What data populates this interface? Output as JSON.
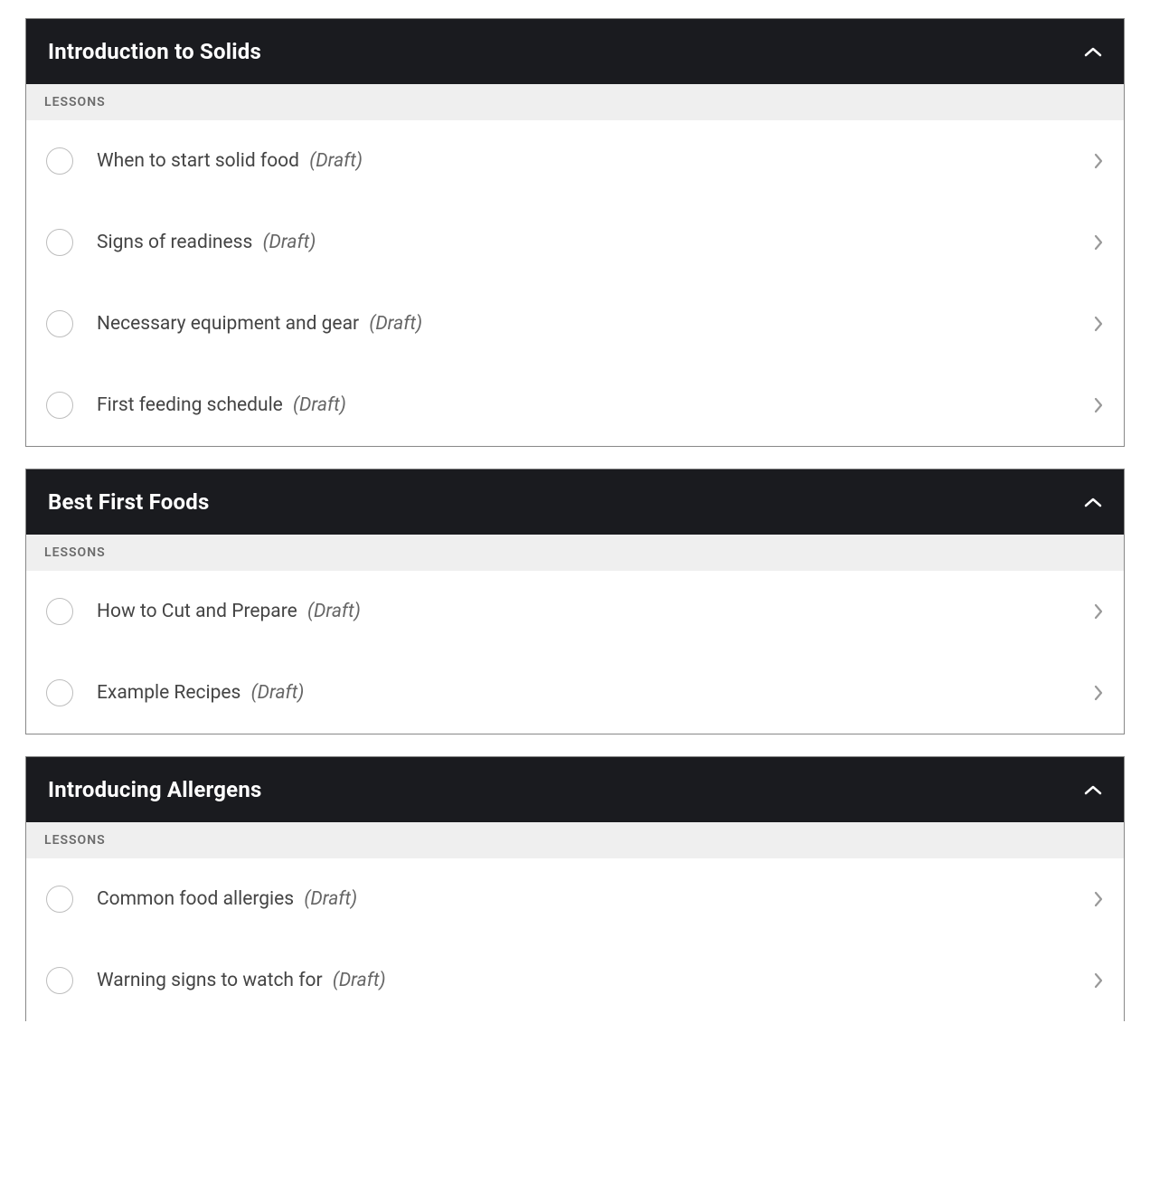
{
  "lessons_label": "LESSONS",
  "status_open_paren": "(",
  "status_close_paren": ")",
  "modules": [
    {
      "title": "Introduction to Solids",
      "lessons": [
        {
          "title": "When to start solid food",
          "status": "Draft"
        },
        {
          "title": "Signs of readiness",
          "status": "Draft"
        },
        {
          "title": "Necessary equipment and gear",
          "status": "Draft"
        },
        {
          "title": "First feeding schedule",
          "status": "Draft"
        }
      ]
    },
    {
      "title": "Best First Foods",
      "lessons": [
        {
          "title": "How to Cut and Prepare",
          "status": "Draft"
        },
        {
          "title": "Example Recipes",
          "status": "Draft"
        }
      ]
    },
    {
      "title": "Introducing Allergens",
      "lessons": [
        {
          "title": "Common food allergies",
          "status": "Draft"
        },
        {
          "title": "Warning signs to watch for",
          "status": "Draft"
        }
      ]
    }
  ]
}
